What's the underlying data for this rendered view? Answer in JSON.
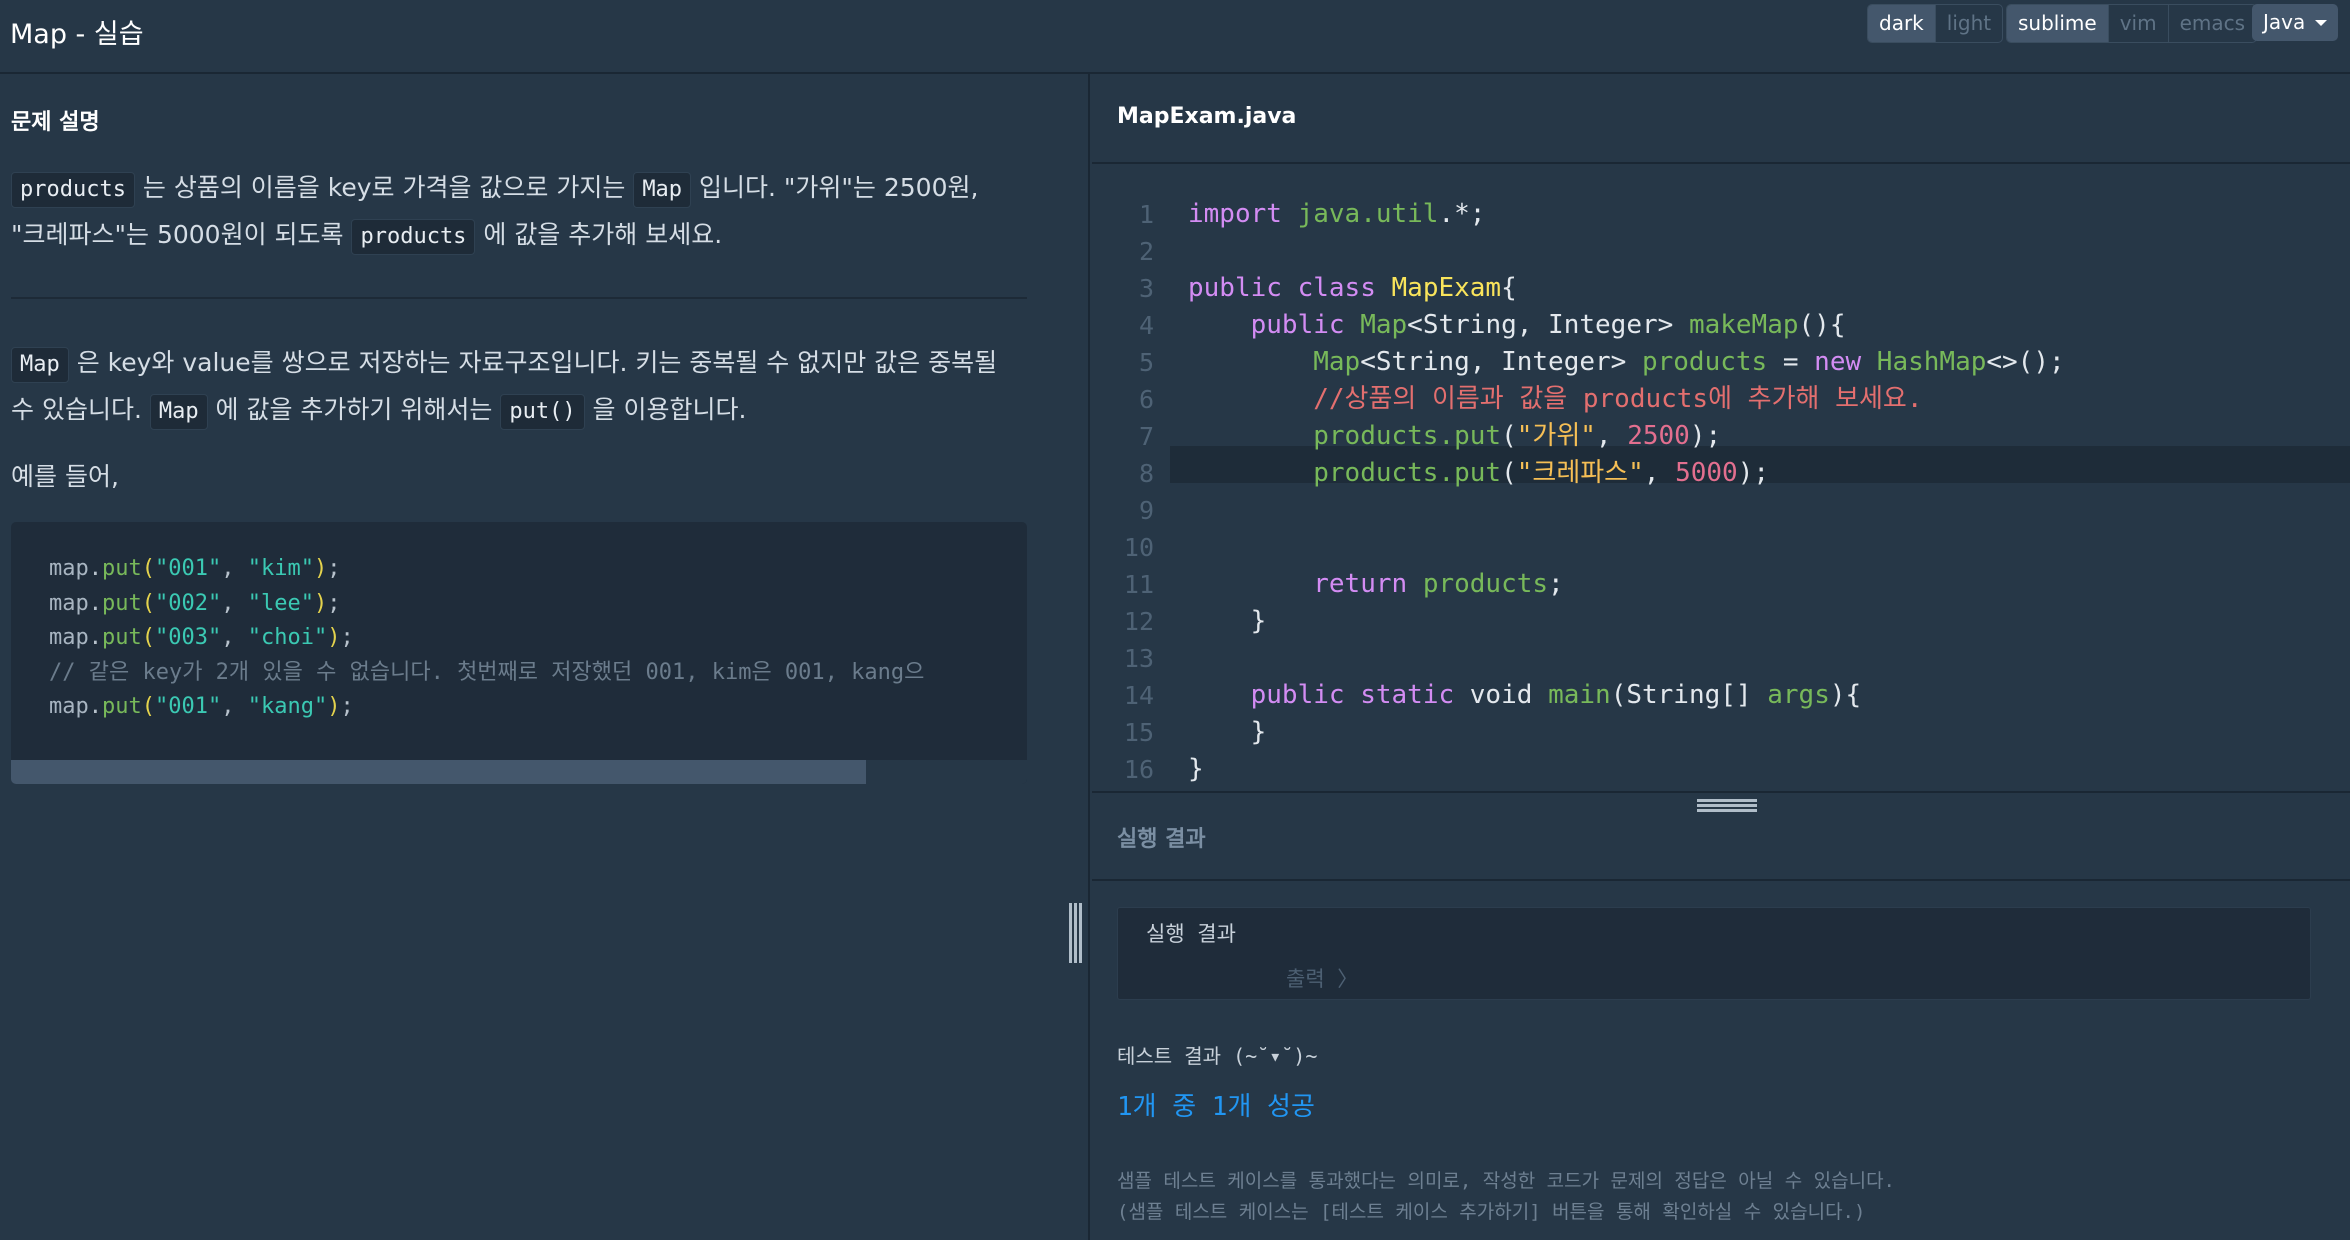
{
  "header": {
    "title": "Map - 실습",
    "theme": [
      "dark",
      "light"
    ],
    "theme_selected": "dark",
    "keymap": [
      "sublime",
      "vim",
      "emacs"
    ],
    "keymap_selected": "sublime",
    "language": "Java"
  },
  "problem": {
    "heading": "문제 설명",
    "p1": {
      "code1": "products",
      "t1": " 는 상품의 이름을 key로 가격을 값으로 가지는 ",
      "code2": "Map",
      "t2": " 입니다. \"가위\"는 2500원,",
      "t3": "\"크레파스\"는 5000원이 되도록 ",
      "code3": "products",
      "t4": " 에 값을 추가해 보세요."
    },
    "p2": {
      "code1": "Map",
      "t1": " 은 key와 value를 쌍으로 저장하는 자료구조입니다. 키는 중복될 수 없지만 값은 중복될",
      "t2": "수 있습니다. ",
      "code2": "Map",
      "t3": " 에 값을 추가하기 위해서는 ",
      "code3": "put()",
      "t4": " 을 이용합니다."
    },
    "p3": "예를 들어,",
    "example": [
      {
        "obj": "map",
        "fn": "put",
        "a": "\"001\"",
        "b": "\"kim\""
      },
      {
        "obj": "map",
        "fn": "put",
        "a": "\"002\"",
        "b": "\"lee\""
      },
      {
        "obj": "map",
        "fn": "put",
        "a": "\"003\"",
        "b": "\"choi\""
      },
      {
        "comment": "// 같은 key가 2개 있을 수 없습니다. 첫번째로 저장했던 001, kim은 001, kang으"
      },
      {
        "obj": "map",
        "fn": "put",
        "a": "\"001\"",
        "b": "\"kang\""
      }
    ]
  },
  "editor": {
    "file_name": "MapExam.java",
    "line_numbers": [
      "1",
      "2",
      "3",
      "4",
      "5",
      "6",
      "7",
      "8",
      "9",
      "10",
      "11",
      "12",
      "13",
      "14",
      "15",
      "16"
    ],
    "code": {
      "import_kw": "import",
      "import_pkg": "java.util",
      "import_rest": ".*;",
      "public1": "public",
      "class_kw": "class",
      "class_name": "MapExam",
      "brace": "{",
      "public2": "public",
      "map_type": "Map",
      "generic": "<String, Integer> ",
      "method": "makeMap",
      "method_tail": "(){",
      "decl_type": "Map",
      "decl_generic": "<String, Integer> ",
      "var": "products",
      "assign": " = ",
      "new_kw": "new",
      "hash": "HashMap",
      "hash_tail": "<>();",
      "comment": "//상품의 이름과 값을 products에 추가해 보세요.",
      "put1_var": "products",
      "put1_fn": ".put",
      "put1_str": "\"가위\"",
      "put1_num": "2500",
      "put2_var": "products",
      "put2_fn": ".put",
      "put2_str": "\"크레파스\"",
      "put2_num": "5000",
      "return_kw": "return",
      "return_var": "products",
      "semi": ";",
      "close": "}",
      "main_public": "public",
      "main_static": "static",
      "main_void": "void",
      "main_name": "main",
      "main_args": "(String[] ",
      "main_argname": "args",
      "main_tail": "){",
      "close_inner": "}",
      "close_outer": "}"
    }
  },
  "result": {
    "heading": "실행 결과",
    "output_label": "실행 결과",
    "output_sub": "출력 〉",
    "test_title": "테스트 결과 (~˘▾˘)~",
    "test_pass": "1개 중 1개 성공",
    "note1": "샘플 테스트 케이스를 통과했다는 의미로, 작성한 코드가 문제의 정답은 아닐 수 있습니다.",
    "note2": "(샘플 테스트 케이스는 [테스트 케이스 추가하기] 버튼을 통해 확인하실 수 있습니다.)"
  }
}
